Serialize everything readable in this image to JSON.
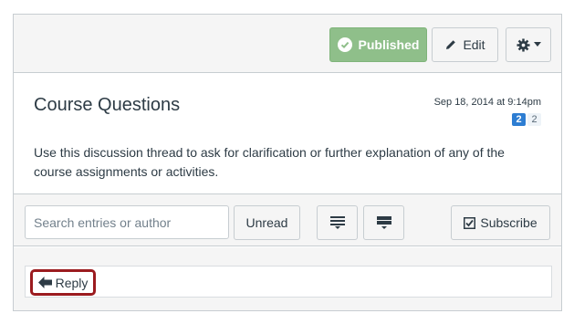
{
  "header": {
    "published_label": "Published",
    "edit_label": "Edit"
  },
  "entry": {
    "title": "Course Questions",
    "date": "Sep 18, 2014 at 9:14pm",
    "unread_count": "2",
    "total_count": "2",
    "body": "Use this discussion thread to ask for clarification or further explanation of any of the course assignments or activities."
  },
  "toolbar": {
    "search_placeholder": "Search entries or author",
    "unread_label": "Unread",
    "subscribe_label": "Subscribe"
  },
  "reply": {
    "label": "Reply"
  },
  "colors": {
    "published_bg": "#8fbf8a",
    "badge_blue": "#2d7dd2",
    "reply_highlight": "#9b1b1f"
  },
  "icons": {
    "published": "check-circle-icon",
    "edit": "pencil-icon",
    "settings": "gear-icon",
    "settings_caret": "caret-down-icon",
    "collapse": "collapse-threads-icon",
    "expand": "expand-threads-icon",
    "subscribe": "checkbox-icon",
    "reply": "arrow-left-icon"
  }
}
